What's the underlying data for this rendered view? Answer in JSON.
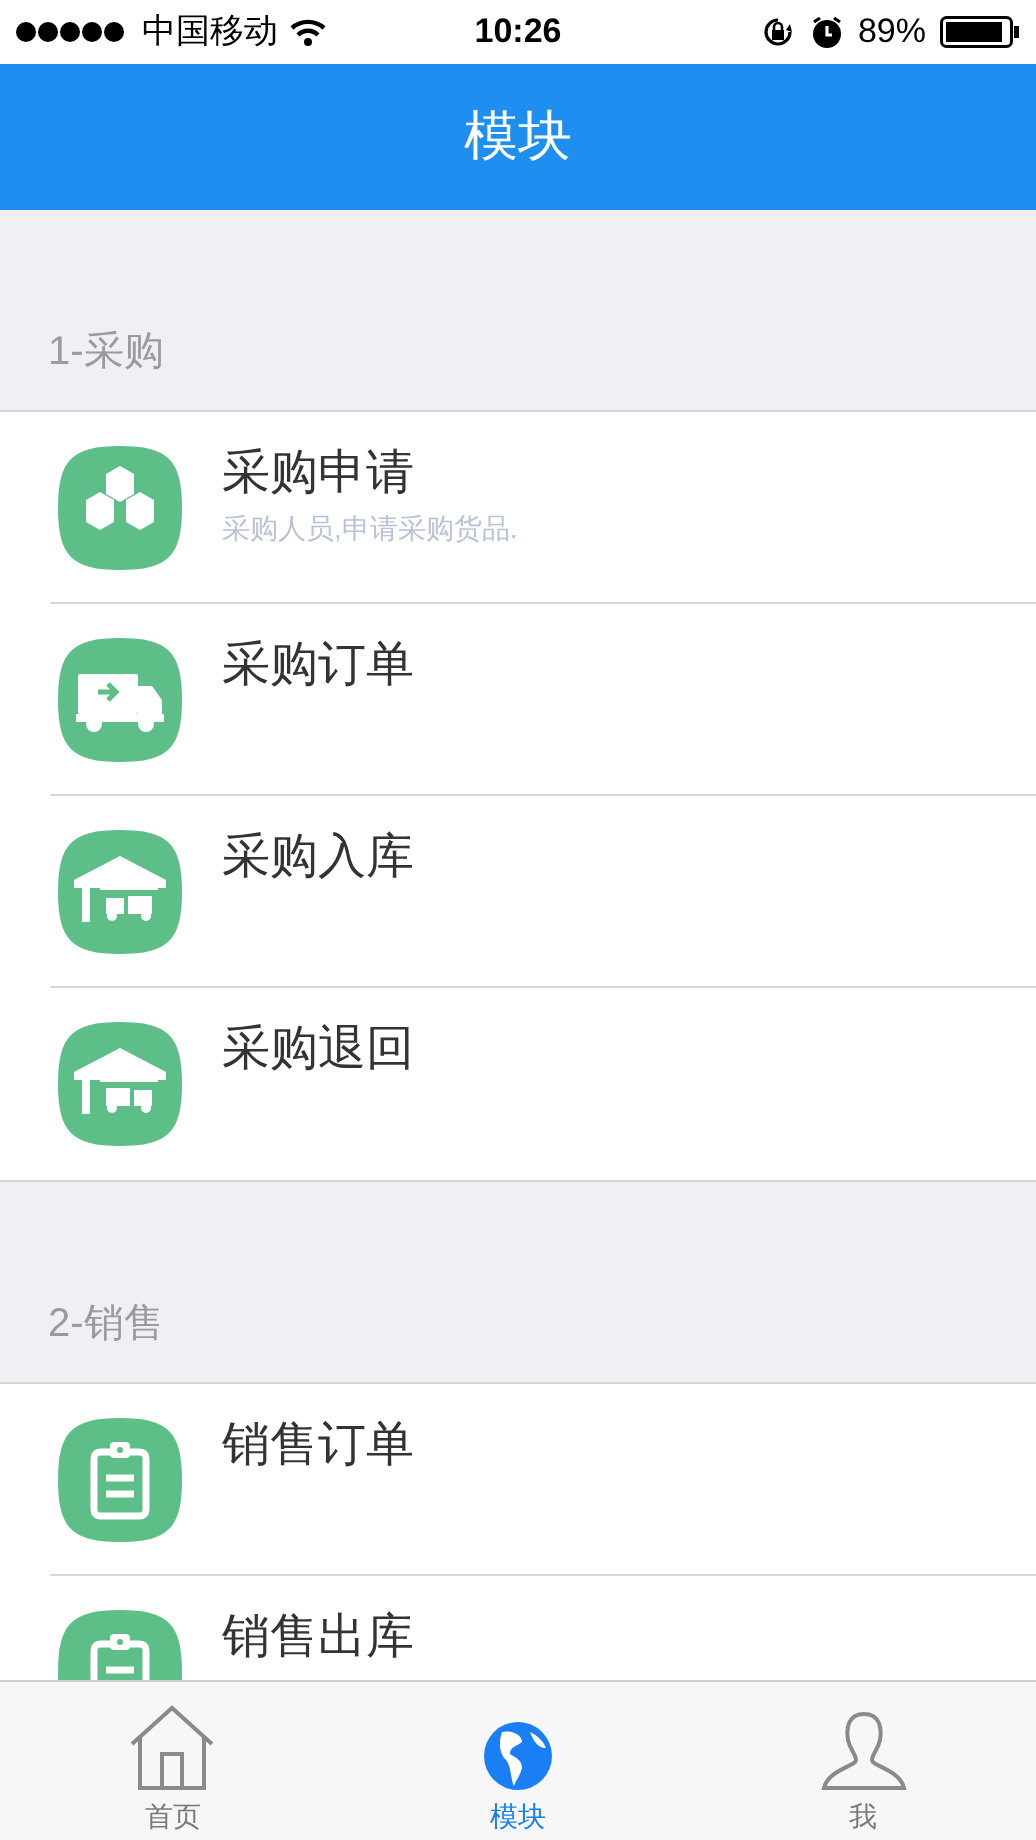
{
  "status_bar": {
    "carrier": "中国移动",
    "time": "10:26",
    "battery": "89%"
  },
  "header": {
    "title": "模块"
  },
  "sections": [
    {
      "title": "1-采购",
      "items": [
        {
          "title": "采购申请",
          "subtitle": "采购人员,申请采购货品."
        },
        {
          "title": "采购订单"
        },
        {
          "title": "采购入库"
        },
        {
          "title": "采购退回"
        }
      ]
    },
    {
      "title": "2-销售",
      "items": [
        {
          "title": "销售订单"
        },
        {
          "title": "销售出库"
        }
      ]
    }
  ],
  "tab_bar": [
    {
      "label": "首页",
      "selected": false
    },
    {
      "label": "模块",
      "selected": true
    },
    {
      "label": "我",
      "selected": false
    }
  ]
}
